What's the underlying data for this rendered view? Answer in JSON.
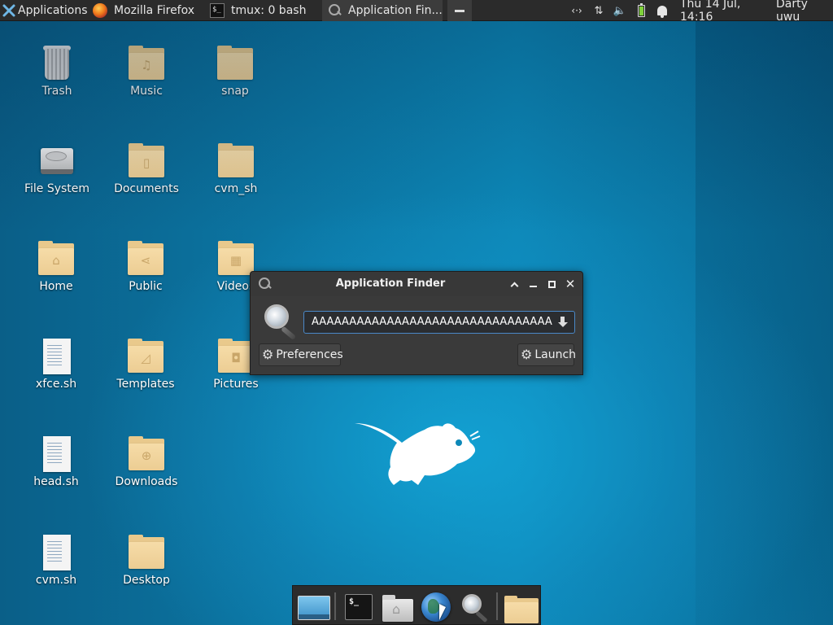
{
  "panel": {
    "applications_label": "Applications",
    "tasks": [
      {
        "label": "Mozilla Firefox",
        "icon": "firefox-icon"
      },
      {
        "label": "tmux: 0 bash",
        "icon": "terminal-icon"
      },
      {
        "label": "Application Fin...",
        "icon": "search-icon",
        "active": true
      }
    ],
    "tray": {
      "network_icon": "network-icon",
      "network_glyph": "‹·›",
      "updown_icon": "transfer-icon",
      "updown_glyph": "⇅",
      "volume_icon": "volume-icon",
      "volume_glyph": "🔈",
      "battery_icon": "battery-icon",
      "notification_icon": "bell-icon"
    },
    "clock": "Thu 14 Jul, 14:16",
    "user": "Darty uwu"
  },
  "desktop": {
    "icons": [
      {
        "label": "Trash",
        "icon": "trash-icon"
      },
      {
        "label": "Music",
        "icon": "music-folder-icon",
        "glyph": "♫"
      },
      {
        "label": "snap",
        "icon": "folder-icon"
      },
      {
        "label": "File System",
        "icon": "harddisk-icon"
      },
      {
        "label": "Documents",
        "icon": "documents-folder-icon",
        "glyph": "▯"
      },
      {
        "label": "cvm_sh",
        "icon": "folder-icon"
      },
      {
        "label": "Home",
        "icon": "home-folder-icon",
        "glyph": "⌂"
      },
      {
        "label": "Public",
        "icon": "public-folder-icon",
        "glyph": "⋖"
      },
      {
        "label": "Videos",
        "icon": "videos-folder-icon",
        "glyph": "▦"
      },
      {
        "label": "xfce.sh",
        "icon": "script-file-icon"
      },
      {
        "label": "Templates",
        "icon": "templates-folder-icon",
        "glyph": "◿"
      },
      {
        "label": "Pictures",
        "icon": "pictures-folder-icon",
        "glyph": "◘"
      },
      {
        "label": "head.sh",
        "icon": "script-file-icon"
      },
      {
        "label": "Downloads",
        "icon": "downloads-folder-icon",
        "glyph": "⊕"
      },
      {
        "label": "cvm.sh",
        "icon": "script-file-icon"
      },
      {
        "label": "Desktop",
        "icon": "folder-icon"
      }
    ]
  },
  "app_finder": {
    "title": "Application Finder",
    "search_value": "AAAAAAAAAAAAAAAAAAAAAAAAAAAAAAAAAAAAAA",
    "preferences_label": "Preferences",
    "launch_label": "Launch",
    "preferences_glyph": "⚙",
    "launch_glyph": "⚙",
    "close_glyph": "✕"
  },
  "dock": {
    "items": [
      "show-desktop-icon",
      "terminal-icon",
      "home-folder-icon",
      "web-browser-icon",
      "app-finder-icon",
      "file-manager-icon"
    ],
    "terminal_glyph": "$_"
  },
  "colors": {
    "panel_bg": "#2b2b2b",
    "desktop_accent": "#0d88b8",
    "folder": "#eccd93",
    "search_border": "#4a88c7"
  }
}
